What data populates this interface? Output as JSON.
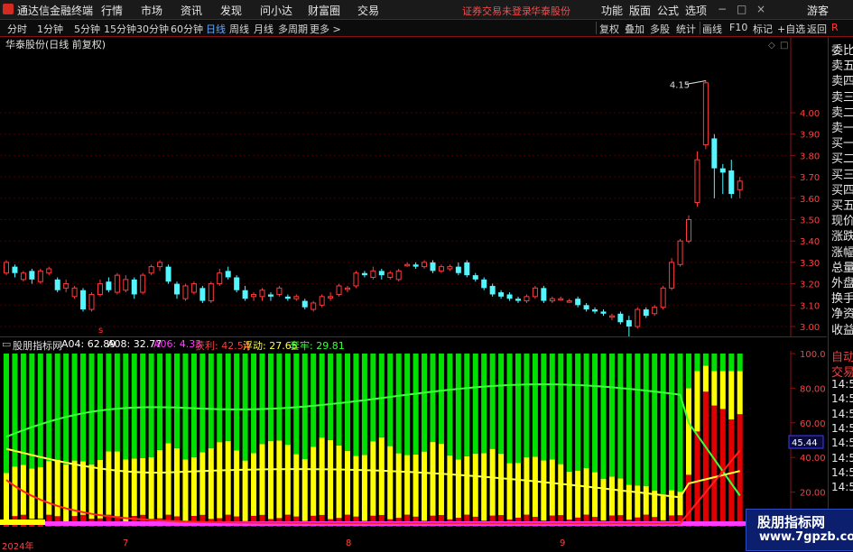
{
  "app": {
    "title": "通达信金融终端",
    "menu": [
      "行情",
      "市场",
      "资讯",
      "发现",
      "问小达",
      "财富圈",
      "交易"
    ],
    "status_warning": "证券交易未登录",
    "stock_link": "华泰股份",
    "right_menu": [
      "功能",
      "版面",
      "公式",
      "选项"
    ],
    "window_user": "游客",
    "window_controls": [
      "−",
      "□",
      "×"
    ]
  },
  "toolbar": {
    "periods": [
      "分时",
      "1分钟",
      "5分钟",
      "15分钟",
      "30分钟",
      "60分钟",
      "日线",
      "周线",
      "月线",
      "多周期",
      "更多 >"
    ],
    "selected": "日线",
    "actions": [
      "复权",
      "叠加",
      "多股",
      "统计",
      "画线",
      "F10",
      "标记",
      "+自选",
      "返回"
    ]
  },
  "price_chart": {
    "title": "华泰股份(日线 前复权)",
    "y_ticks": [
      "4.00",
      "3.90",
      "3.80",
      "3.70",
      "3.60",
      "3.50",
      "3.40",
      "3.30",
      "3.20",
      "3.10",
      "3.00"
    ],
    "high_label": "4.15",
    "low_label": "2.94",
    "marker": "s",
    "colors": {
      "up": "#ff3b3b",
      "down": "#54f5ff",
      "grid": "#5a0000"
    }
  },
  "indicator": {
    "name": "股朋指标网",
    "values": [
      {
        "label": "A04: 62.89",
        "color": "#ffffff"
      },
      {
        "label": "A08: 32.77",
        "color": "#ffffff"
      },
      {
        "label": "A06: 4.33",
        "color": "#ff3bff"
      },
      {
        "label": "获利: 42.54",
        "color": "#ff3b3b"
      },
      {
        "label": "浮动: 27.65",
        "color": "#ffff3b"
      },
      {
        "label": "套牢: 29.81",
        "color": "#3bff3b"
      }
    ],
    "y_ticks": [
      "100.0",
      "80.00",
      "60.00",
      "40.00",
      "20.00"
    ],
    "current_value": "45.44"
  },
  "x_axis": {
    "labels": [
      "2024年",
      "7",
      "8",
      "9"
    ]
  },
  "right_panel": {
    "items": [
      "委比",
      "卖五",
      "卖四",
      "卖三",
      "卖二",
      "卖一",
      "买一",
      "买二",
      "买三",
      "买四",
      "买五",
      "现价",
      "涨跌",
      "涨幅",
      "总量",
      "外盘",
      "换手",
      "净资",
      "收益"
    ],
    "lower_items": [
      "自动",
      "交易"
    ],
    "times": [
      "14:55",
      "14:55",
      "14:56",
      "14:56",
      "14:56",
      "14:56",
      "14:56",
      "14:56"
    ]
  },
  "watermark": {
    "name": "股朋指标网",
    "url": "www.7gpzb.com"
  },
  "chart_data": {
    "type": "candlestick",
    "title": "华泰股份(日线 前复权)",
    "ylim": [
      2.9,
      4.2
    ],
    "candles": [
      [
        3.25,
        3.3,
        3.31,
        3.24
      ],
      [
        3.28,
        3.25,
        3.29,
        3.23
      ],
      [
        3.22,
        3.25,
        3.26,
        3.21
      ],
      [
        3.26,
        3.22,
        3.27,
        3.2
      ],
      [
        3.21,
        3.26,
        3.27,
        3.2
      ],
      [
        3.25,
        3.27,
        3.28,
        3.24
      ],
      [
        3.22,
        3.17,
        3.23,
        3.16
      ],
      [
        3.18,
        3.2,
        3.22,
        3.16
      ],
      [
        3.14,
        3.18,
        3.19,
        3.13
      ],
      [
        3.17,
        3.08,
        3.18,
        3.07
      ],
      [
        3.08,
        3.15,
        3.16,
        3.07
      ],
      [
        3.15,
        3.2,
        3.22,
        3.14
      ],
      [
        3.21,
        3.17,
        3.23,
        3.16
      ],
      [
        3.16,
        3.24,
        3.25,
        3.15
      ],
      [
        3.17,
        3.22,
        3.24,
        3.16
      ],
      [
        3.22,
        3.15,
        3.23,
        3.13
      ],
      [
        3.16,
        3.24,
        3.25,
        3.15
      ],
      [
        3.25,
        3.28,
        3.29,
        3.24
      ],
      [
        3.28,
        3.3,
        3.31,
        3.26
      ],
      [
        3.28,
        3.21,
        3.29,
        3.2
      ],
      [
        3.2,
        3.15,
        3.21,
        3.13
      ],
      [
        3.13,
        3.19,
        3.2,
        3.12
      ],
      [
        3.16,
        3.2,
        3.21,
        3.15
      ],
      [
        3.18,
        3.12,
        3.19,
        3.11
      ],
      [
        3.12,
        3.2,
        3.21,
        3.11
      ],
      [
        3.2,
        3.25,
        3.27,
        3.19
      ],
      [
        3.26,
        3.23,
        3.28,
        3.22
      ],
      [
        3.23,
        3.17,
        3.24,
        3.16
      ],
      [
        3.17,
        3.13,
        3.19,
        3.12
      ],
      [
        3.14,
        3.15,
        3.16,
        3.12
      ],
      [
        3.14,
        3.17,
        3.18,
        3.12
      ],
      [
        3.15,
        3.14,
        3.16,
        3.12
      ],
      [
        3.15,
        3.18,
        3.19,
        3.14
      ],
      [
        3.14,
        3.13,
        3.15,
        3.12
      ],
      [
        3.13,
        3.14,
        3.15,
        3.12
      ],
      [
        3.12,
        3.09,
        3.13,
        3.08
      ],
      [
        3.08,
        3.11,
        3.12,
        3.07
      ],
      [
        3.1,
        3.14,
        3.15,
        3.09
      ],
      [
        3.14,
        3.14,
        3.16,
        3.12
      ],
      [
        3.15,
        3.19,
        3.2,
        3.14
      ],
      [
        3.18,
        3.18,
        3.19,
        3.16
      ],
      [
        3.19,
        3.25,
        3.26,
        3.18
      ],
      [
        3.25,
        3.24,
        3.26,
        3.23
      ],
      [
        3.23,
        3.26,
        3.28,
        3.22
      ],
      [
        3.26,
        3.24,
        3.27,
        3.22
      ],
      [
        3.23,
        3.25,
        3.26,
        3.22
      ],
      [
        3.22,
        3.26,
        3.27,
        3.21
      ],
      [
        3.29,
        3.29,
        3.3,
        3.28
      ],
      [
        3.29,
        3.28,
        3.3,
        3.27
      ],
      [
        3.28,
        3.3,
        3.31,
        3.27
      ],
      [
        3.3,
        3.26,
        3.31,
        3.25
      ],
      [
        3.26,
        3.28,
        3.29,
        3.25
      ],
      [
        3.27,
        3.28,
        3.29,
        3.26
      ],
      [
        3.28,
        3.25,
        3.3,
        3.24
      ],
      [
        3.3,
        3.24,
        3.31,
        3.23
      ],
      [
        3.24,
        3.22,
        3.25,
        3.21
      ],
      [
        3.22,
        3.18,
        3.23,
        3.17
      ],
      [
        3.19,
        3.15,
        3.2,
        3.14
      ],
      [
        3.16,
        3.14,
        3.17,
        3.13
      ],
      [
        3.15,
        3.13,
        3.16,
        3.12
      ],
      [
        3.13,
        3.12,
        3.14,
        3.11
      ],
      [
        3.12,
        3.14,
        3.15,
        3.11
      ],
      [
        3.14,
        3.18,
        3.19,
        3.13
      ],
      [
        3.18,
        3.12,
        3.19,
        3.11
      ],
      [
        3.12,
        3.13,
        3.14,
        3.11
      ],
      [
        3.13,
        3.13,
        3.14,
        3.12
      ],
      [
        3.12,
        3.12,
        3.13,
        3.11
      ],
      [
        3.13,
        3.1,
        3.14,
        3.09
      ],
      [
        3.1,
        3.08,
        3.11,
        3.07
      ],
      [
        3.08,
        3.07,
        3.09,
        3.06
      ],
      [
        3.07,
        3.06,
        3.08,
        3.05
      ],
      [
        3.05,
        3.05,
        3.06,
        3.03
      ],
      [
        3.06,
        3.02,
        3.07,
        3.01
      ],
      [
        3.03,
        3.0,
        3.05,
        2.94
      ],
      [
        3.0,
        3.08,
        3.09,
        2.99
      ],
      [
        3.08,
        3.05,
        3.09,
        3.04
      ],
      [
        3.06,
        3.09,
        3.1,
        3.05
      ],
      [
        3.09,
        3.18,
        3.19,
        3.08
      ],
      [
        3.18,
        3.3,
        3.32,
        3.17
      ],
      [
        3.29,
        3.4,
        3.41,
        3.28
      ],
      [
        3.4,
        3.5,
        3.52,
        3.39
      ],
      [
        3.58,
        3.78,
        3.82,
        3.56
      ],
      [
        3.85,
        4.14,
        4.15,
        3.83
      ],
      [
        3.88,
        3.74,
        3.9,
        3.6
      ],
      [
        3.74,
        3.72,
        3.76,
        3.62
      ],
      [
        3.73,
        3.62,
        3.78,
        3.6
      ],
      [
        3.64,
        3.68,
        3.7,
        3.6
      ]
    ]
  }
}
